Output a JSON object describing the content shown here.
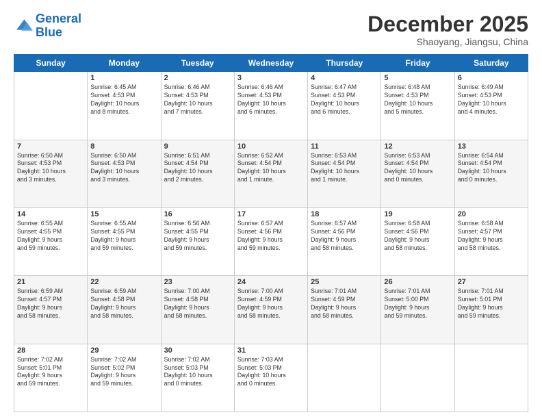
{
  "header": {
    "logo_line1": "General",
    "logo_line2": "Blue",
    "month_title": "December 2025",
    "location": "Shaoyang, Jiangsu, China"
  },
  "weekdays": [
    "Sunday",
    "Monday",
    "Tuesday",
    "Wednesday",
    "Thursday",
    "Friday",
    "Saturday"
  ],
  "weeks": [
    [
      {
        "day": "",
        "info": ""
      },
      {
        "day": "1",
        "info": "Sunrise: 6:45 AM\nSunset: 4:53 PM\nDaylight: 10 hours\nand 8 minutes."
      },
      {
        "day": "2",
        "info": "Sunrise: 6:46 AM\nSunset: 4:53 PM\nDaylight: 10 hours\nand 7 minutes."
      },
      {
        "day": "3",
        "info": "Sunrise: 6:46 AM\nSunset: 4:53 PM\nDaylight: 10 hours\nand 6 minutes."
      },
      {
        "day": "4",
        "info": "Sunrise: 6:47 AM\nSunset: 4:53 PM\nDaylight: 10 hours\nand 6 minutes."
      },
      {
        "day": "5",
        "info": "Sunrise: 6:48 AM\nSunset: 4:53 PM\nDaylight: 10 hours\nand 5 minutes."
      },
      {
        "day": "6",
        "info": "Sunrise: 6:49 AM\nSunset: 4:53 PM\nDaylight: 10 hours\nand 4 minutes."
      }
    ],
    [
      {
        "day": "7",
        "info": "Sunrise: 6:50 AM\nSunset: 4:53 PM\nDaylight: 10 hours\nand 3 minutes."
      },
      {
        "day": "8",
        "info": "Sunrise: 6:50 AM\nSunset: 4:53 PM\nDaylight: 10 hours\nand 3 minutes."
      },
      {
        "day": "9",
        "info": "Sunrise: 6:51 AM\nSunset: 4:54 PM\nDaylight: 10 hours\nand 2 minutes."
      },
      {
        "day": "10",
        "info": "Sunrise: 6:52 AM\nSunset: 4:54 PM\nDaylight: 10 hours\nand 1 minute."
      },
      {
        "day": "11",
        "info": "Sunrise: 6:53 AM\nSunset: 4:54 PM\nDaylight: 10 hours\nand 1 minute."
      },
      {
        "day": "12",
        "info": "Sunrise: 6:53 AM\nSunset: 4:54 PM\nDaylight: 10 hours\nand 0 minutes."
      },
      {
        "day": "13",
        "info": "Sunrise: 6:54 AM\nSunset: 4:54 PM\nDaylight: 10 hours\nand 0 minutes."
      }
    ],
    [
      {
        "day": "14",
        "info": "Sunrise: 6:55 AM\nSunset: 4:55 PM\nDaylight: 9 hours\nand 59 minutes."
      },
      {
        "day": "15",
        "info": "Sunrise: 6:55 AM\nSunset: 4:55 PM\nDaylight: 9 hours\nand 59 minutes."
      },
      {
        "day": "16",
        "info": "Sunrise: 6:56 AM\nSunset: 4:55 PM\nDaylight: 9 hours\nand 59 minutes."
      },
      {
        "day": "17",
        "info": "Sunrise: 6:57 AM\nSunset: 4:56 PM\nDaylight: 9 hours\nand 59 minutes."
      },
      {
        "day": "18",
        "info": "Sunrise: 6:57 AM\nSunset: 4:56 PM\nDaylight: 9 hours\nand 58 minutes."
      },
      {
        "day": "19",
        "info": "Sunrise: 6:58 AM\nSunset: 4:56 PM\nDaylight: 9 hours\nand 58 minutes."
      },
      {
        "day": "20",
        "info": "Sunrise: 6:58 AM\nSunset: 4:57 PM\nDaylight: 9 hours\nand 58 minutes."
      }
    ],
    [
      {
        "day": "21",
        "info": "Sunrise: 6:59 AM\nSunset: 4:57 PM\nDaylight: 9 hours\nand 58 minutes."
      },
      {
        "day": "22",
        "info": "Sunrise: 6:59 AM\nSunset: 4:58 PM\nDaylight: 9 hours\nand 58 minutes."
      },
      {
        "day": "23",
        "info": "Sunrise: 7:00 AM\nSunset: 4:58 PM\nDaylight: 9 hours\nand 58 minutes."
      },
      {
        "day": "24",
        "info": "Sunrise: 7:00 AM\nSunset: 4:59 PM\nDaylight: 9 hours\nand 58 minutes."
      },
      {
        "day": "25",
        "info": "Sunrise: 7:01 AM\nSunset: 4:59 PM\nDaylight: 9 hours\nand 58 minutes."
      },
      {
        "day": "26",
        "info": "Sunrise: 7:01 AM\nSunset: 5:00 PM\nDaylight: 9 hours\nand 59 minutes."
      },
      {
        "day": "27",
        "info": "Sunrise: 7:01 AM\nSunset: 5:01 PM\nDaylight: 9 hours\nand 59 minutes."
      }
    ],
    [
      {
        "day": "28",
        "info": "Sunrise: 7:02 AM\nSunset: 5:01 PM\nDaylight: 9 hours\nand 59 minutes."
      },
      {
        "day": "29",
        "info": "Sunrise: 7:02 AM\nSunset: 5:02 PM\nDaylight: 9 hours\nand 59 minutes."
      },
      {
        "day": "30",
        "info": "Sunrise: 7:02 AM\nSunset: 5:03 PM\nDaylight: 10 hours\nand 0 minutes."
      },
      {
        "day": "31",
        "info": "Sunrise: 7:03 AM\nSunset: 5:03 PM\nDaylight: 10 hours\nand 0 minutes."
      },
      {
        "day": "",
        "info": ""
      },
      {
        "day": "",
        "info": ""
      },
      {
        "day": "",
        "info": ""
      }
    ]
  ]
}
